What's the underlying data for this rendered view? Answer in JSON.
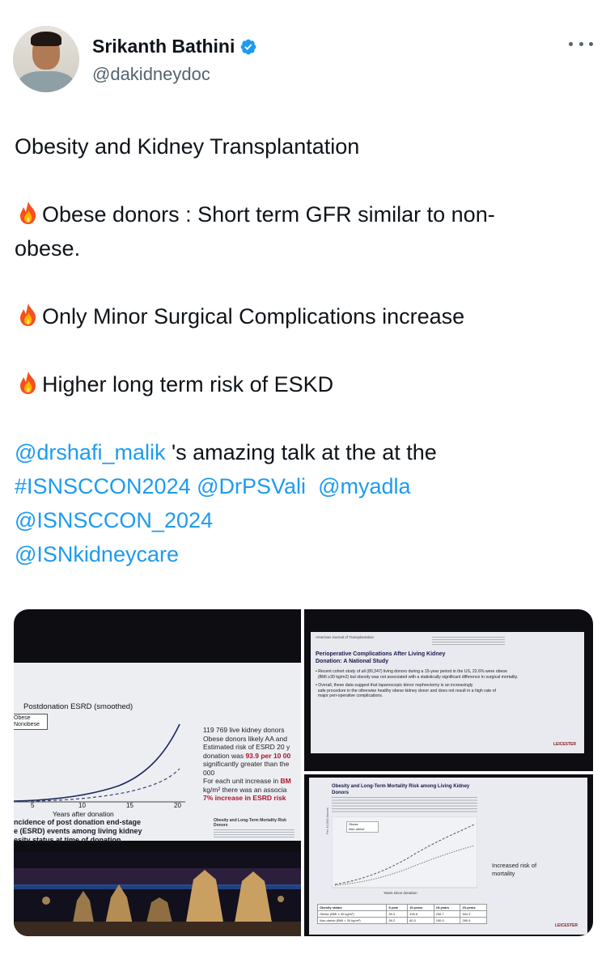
{
  "author": {
    "display_name": "Srikanth Bathini",
    "handle": "@dakidneydoc",
    "verified": true,
    "badge_color": "#1d9bf0"
  },
  "tweet": {
    "title": "Obesity and Kidney Transplantation",
    "point1": "Obese donors : Short term GFR similar to non-",
    "point1_cont": "obese.",
    "point2": "Only Minor Surgical Complications increase",
    "point3": "Higher long term risk of ESKD",
    "mention_main": "@drshafi_malik",
    "talk_text": " 's amazing talk at the at the",
    "hashtag": "#ISNSCCON2024",
    "mention_2": "@DrPSVali",
    "mention_3": "@myadla",
    "mention_4": "@ISNSCCON_2024",
    "mention_5": "@ISNkidneycare",
    "link_color": "#1d9bf0",
    "bullet_icon": "fire-emoji"
  },
  "media": {
    "left_slide": {
      "chart_title": "Postdonation ESRD (smoothed)",
      "legend_obese": "Obese",
      "legend_nonobese": "Nonobese",
      "axis_tick_5": "5",
      "axis_tick_10": "10",
      "axis_tick_15": "15",
      "axis_tick_20": "20",
      "x_label": "Years after donation",
      "caption_1": "ncidence of post donation end-stage",
      "caption_2": "e (ESRD) events among living kidney",
      "caption_3": "esity status at time of donation.",
      "info_1": "119 769 live kidney donors",
      "info_2": "Obese donors likely AA and",
      "info_3": "Estimated risk of ESRD 20 y",
      "info_4_pre": "donation was ",
      "info_4_red": "93.9 per 10 00",
      "info_5": "significantly greater than the",
      "info_6": "000",
      "info_7_pre": "For each unit increase in ",
      "info_7_red": "BM",
      "info_8": "kg/m² there was an associa",
      "info_9_red": "7% increase in ESRD risk",
      "ref_title": "Obesity and Long-Term Mortality Risk",
      "ref_sub": "Donors"
    },
    "top_right_slide": {
      "journal": "American Journal of Transplantation",
      "title_1": "Perioperative Complications After Living Kidney",
      "title_2": "Donation: A National Study",
      "bullet_1a": "Recent cohort study of all (80,347) living donors during a 15-year period in the US, 22.6% were obese",
      "bullet_1b": "(BMI ≥30 kg/m2) but obesity was not associated with a statistically significant difference in surgical mortality.",
      "bullet_2a": "Overall, these data suggest that laparoscopic donor nephrectomy is an increasingly",
      "bullet_2b": "safe procedure in the otherwise healthy obese kidney donor and does not result in a high rate of",
      "bullet_2c": "major peri-operative complications.",
      "logo": "LEICESTER"
    },
    "bottom_right_slide": {
      "title_1": "Obesity and Long-Term Mortality Risk among Living Kidney",
      "title_2": "Donors",
      "legend_obese": "Obese",
      "legend_nonobese": "Non-obese",
      "x_label": "Years since donation",
      "y_label": "Per 10,000 donors",
      "note_1": "Increased risk of",
      "note_2": "mortality",
      "table_headers": [
        "Obesity status",
        "5-year",
        "10-years",
        "15-years",
        "20-years"
      ],
      "table_rows": [
        [
          "Obese (BMI ≥ 30 kg/m²)",
          "39.3",
          "105.6",
          "206.7",
          "304.3"
        ],
        [
          "Non-obese (BMI < 30 kg/m²)",
          "28.2",
          "80.3",
          "150.0",
          "280.9"
        ]
      ],
      "logo": "LEICESTER"
    }
  }
}
